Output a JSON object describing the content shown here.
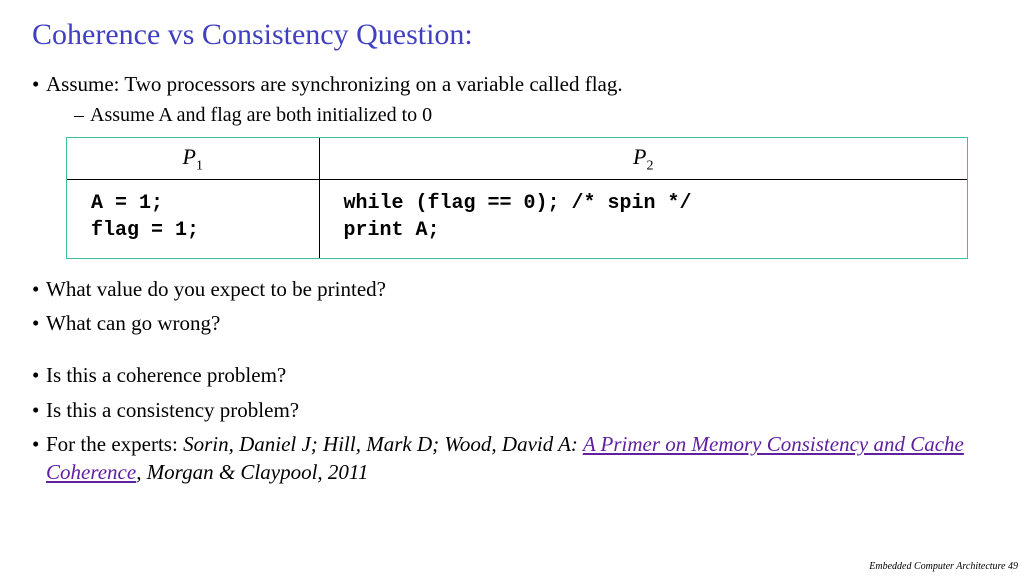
{
  "title": "Coherence vs Consistency Question:",
  "bullets": {
    "assume": "Assume: Two processors are synchronizing on a variable called flag.",
    "assume_sub": "Assume A and flag are both initialized to 0",
    "q1": "What value do you expect to be printed?",
    "q2": "What can go wrong?",
    "q3": "Is this a coherence problem?",
    "q4": "Is this a consistency problem?",
    "experts_prefix": "For the experts: ",
    "experts_authors": "Sorin, Daniel J; Hill, Mark D; Wood, David A: ",
    "experts_link": "A Primer on Memory Consistency and Cache Coherence",
    "experts_suffix": ", Morgan & Claypool, 2011"
  },
  "code": {
    "p1_label": "P",
    "p1_sub": "1",
    "p2_label": "P",
    "p2_sub": "2",
    "p1_code": "A = 1;\nflag = 1;",
    "p2_code": "while (flag == 0); /* spin */\nprint A;"
  },
  "footer": "Embedded Computer Architecture  49"
}
